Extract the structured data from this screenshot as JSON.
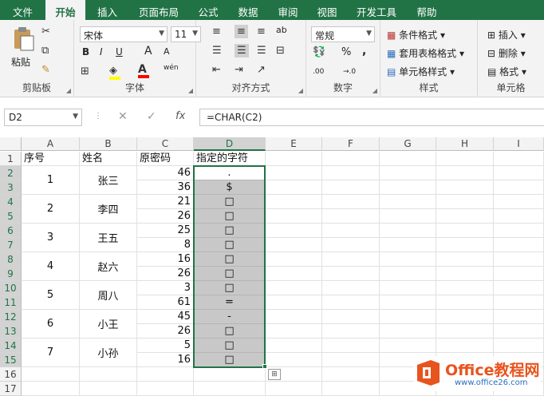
{
  "tabs": [
    "文件",
    "开始",
    "插入",
    "页面布局",
    "公式",
    "数据",
    "审阅",
    "视图",
    "开发工具",
    "帮助"
  ],
  "ribbon": {
    "clipboard": {
      "label": "剪贴板",
      "paste": "粘贴"
    },
    "font": {
      "label": "字体",
      "name": "宋体",
      "size": "11",
      "bold": "B",
      "italic": "I",
      "underline": "U",
      "grow": "A",
      "shrink": "A",
      "fill_color": "#ffff00",
      "font_color": "#ff0000",
      "wen": "wén"
    },
    "alignment": {
      "label": "对齐方式",
      "wrap": "ab"
    },
    "number": {
      "label": "数字",
      "format": "常规",
      "percent": "%",
      "comma": ",",
      "inc": ".00",
      "dec": "→.0"
    },
    "styles": {
      "label": "样式",
      "conditional": "条件格式",
      "table": "套用表格格式",
      "cell": "单元格样式"
    },
    "cells": {
      "label": "单元格",
      "insert": "插入",
      "delete": "删除",
      "format": "格式"
    }
  },
  "formula_bar": {
    "name_box": "D2",
    "cancel": "✕",
    "enter": "✓",
    "fx": "fx",
    "formula": "=CHAR(C2)"
  },
  "columns": [
    "A",
    "B",
    "C",
    "D",
    "E",
    "F",
    "G",
    "H",
    "I"
  ],
  "rows": [
    "1",
    "2",
    "3",
    "4",
    "5",
    "6",
    "7",
    "8",
    "9",
    "10",
    "11",
    "12",
    "13",
    "14",
    "15",
    "16",
    "17"
  ],
  "headers": {
    "a": "序号",
    "b": "姓名",
    "c": "原密码",
    "d": "指定的字符"
  },
  "groups": [
    {
      "no": "1",
      "name": "张三"
    },
    {
      "no": "2",
      "name": "李四"
    },
    {
      "no": "3",
      "name": "王五"
    },
    {
      "no": "4",
      "name": "赵六"
    },
    {
      "no": "5",
      "name": "周八"
    },
    {
      "no": "6",
      "name": "小王"
    },
    {
      "no": "7",
      "name": "小孙"
    }
  ],
  "codes": [
    "46",
    "36",
    "21",
    "26",
    "25",
    "8",
    "16",
    "26",
    "3",
    "61",
    "45",
    "26",
    "5",
    "16"
  ],
  "chars": [
    ".",
    "$",
    "□",
    "□",
    "□",
    "□",
    "□",
    "□",
    "□",
    "=",
    "-",
    "□",
    "□",
    "□"
  ],
  "colors": {
    "accent": "#217346",
    "logo_orange": "#e8541e"
  },
  "logo": {
    "text": "Office教程网",
    "url": "www.office26.com"
  }
}
